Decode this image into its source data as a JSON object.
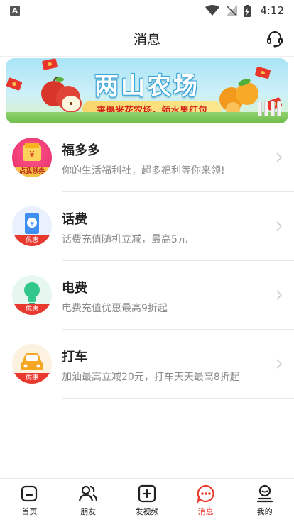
{
  "status_bar": {
    "time": "4:12",
    "notification_letter": "A"
  },
  "header": {
    "title": "消息"
  },
  "banner": {
    "title": "两山农场",
    "subtitle": "来爆米花农场，领水果红包"
  },
  "items": [
    {
      "title": "福多多",
      "subtitle": "你的生活福利社，超多福利等你来领!",
      "badge": "点我领券",
      "icon": "coupon-icon",
      "color": "#e8392f"
    },
    {
      "title": "话费",
      "subtitle": "话费充值随机立减，最高5元",
      "badge": "优惠",
      "icon": "phone-recharge-icon",
      "color": "#3f8ff0"
    },
    {
      "title": "电费",
      "subtitle": "电费充值优惠最高9折起",
      "badge": "优惠",
      "icon": "lightbulb-icon",
      "color": "#32c78a"
    },
    {
      "title": "打车",
      "subtitle": "加油最高立减20元，打车天天最高8折起",
      "badge": "优惠",
      "icon": "taxi-icon",
      "color": "#f5a623"
    }
  ],
  "nav": [
    {
      "label": "首页",
      "icon": "home-icon"
    },
    {
      "label": "朋友",
      "icon": "friends-icon"
    },
    {
      "label": "发视频",
      "icon": "post-video-icon"
    },
    {
      "label": "消息",
      "icon": "message-icon",
      "active": true
    },
    {
      "label": "我的",
      "icon": "profile-icon"
    }
  ],
  "colors": {
    "accent": "#e8392f",
    "divider": "#e8e8e8",
    "subtext": "#8a8a8a"
  }
}
